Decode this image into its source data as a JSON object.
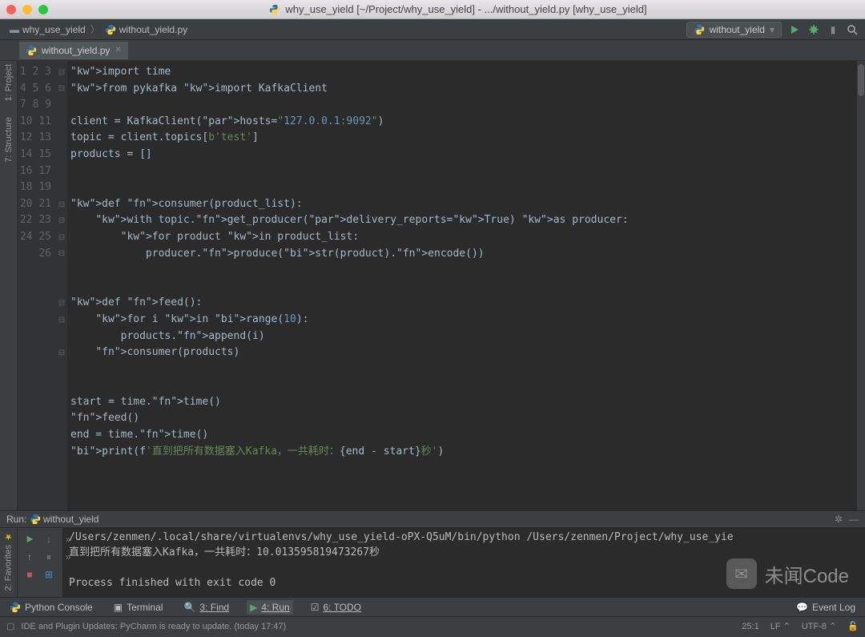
{
  "title": "why_use_yield [~/Project/why_use_yield] - .../without_yield.py [why_use_yield]",
  "breadcrumb": {
    "project": "why_use_yield",
    "file": "without_yield.py"
  },
  "run_config": "without_yield",
  "tab": {
    "name": "without_yield.py"
  },
  "left_rail": {
    "project": "1: Project",
    "structure": "7: Structure"
  },
  "run_rail": {
    "favorites": "2: Favorites"
  },
  "code_lines": [
    "import time",
    "from pykafka import KafkaClient",
    "",
    "client = KafkaClient(hosts=\"127.0.0.1:9092\")",
    "topic = client.topics[b'test']",
    "products = []",
    "",
    "",
    "def consumer(product_list):",
    "    with topic.get_producer(delivery_reports=True) as producer:",
    "        for product in product_list:",
    "            producer.produce(str(product).encode())",
    "",
    "",
    "def feed():",
    "    for i in range(10):",
    "        products.append(i)",
    "    consumer(products)",
    "",
    "",
    "start = time.time()",
    "feed()",
    "end = time.time()",
    "print(f'直到把所有数据塞入Kafka，一共耗时：{end - start}秒')",
    "",
    ""
  ],
  "run_panel": {
    "title_prefix": "Run:",
    "title": "without_yield",
    "lines": [
      "/Users/zenmen/.local/share/virtualenvs/why_use_yield-oPX-Q5uM/bin/python /Users/zenmen/Project/why_use_yie",
      "直到把所有数据塞入Kafka，一共耗时：10.013595819473267秒",
      "",
      "Process finished with exit code 0"
    ]
  },
  "bottom_tabs": {
    "python_console": "Python Console",
    "terminal": "Terminal",
    "find": "3: Find",
    "run": "4: Run",
    "todo": "6: TODO",
    "event_log": "Event Log"
  },
  "status": {
    "message": "IDE and Plugin Updates: PyCharm is ready to update. (today 17:47)",
    "pos": "25:1",
    "lf": "LF",
    "encoding": "UTF-8"
  },
  "watermark": "未闻Code"
}
